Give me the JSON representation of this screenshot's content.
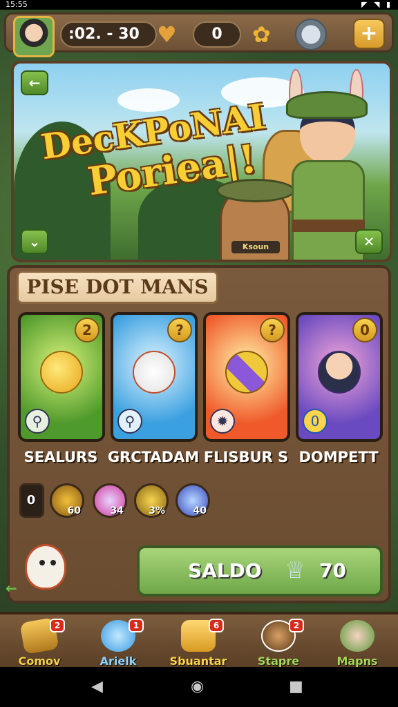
{
  "status": {
    "time": "15:55",
    "icons": [
      "image-icon",
      "mail-icon",
      "signal-icon",
      "wifi-icon",
      "battery-icon"
    ]
  },
  "topbar": {
    "timer": ":02. - 30",
    "coins": "0",
    "icons": {
      "avatar": "player-avatar",
      "heart": "heart-icon",
      "flower": "flower-icon",
      "pet": "pet-raccoon-icon",
      "plus": "plus-icon"
    }
  },
  "banner": {
    "title_line1": "DecKPoNAI",
    "title_line2": "Poriea|!",
    "ranger_tag": "Ksoun",
    "buttons": {
      "back": "←",
      "down": "⌄",
      "close": "✕"
    }
  },
  "panel": {
    "title": "PISE DOT MANS",
    "cards": [
      {
        "label": "SEALURS",
        "badge": "2",
        "color": "#4f9a2c"
      },
      {
        "label": "GRCTADAM",
        "badge": "?",
        "color": "#3aa0e0"
      },
      {
        "label": "FLISBUR S",
        "badge": "?",
        "color": "#f05a2a"
      },
      {
        "label": "DOMPETT",
        "badge": "0",
        "color": "#6a4ac0"
      }
    ],
    "resources": [
      {
        "value": "0",
        "sub": "0"
      },
      {
        "value": "60"
      },
      {
        "value": "34"
      },
      {
        "value": "3%"
      },
      {
        "value": "40"
      }
    ],
    "saldo": {
      "label": "SALDO",
      "amount": "70"
    }
  },
  "bottom_nav": [
    {
      "label": "Comov",
      "count": "2",
      "icon": "bundle-icon"
    },
    {
      "label": "Arielk",
      "count": "1",
      "icon": "cloud-icon"
    },
    {
      "label": "Sbuantar",
      "count": "6",
      "icon": "crate-icon"
    },
    {
      "label": "Stapre",
      "count": "2",
      "icon": "portrait-icon"
    },
    {
      "label": "Mapns",
      "count": "",
      "icon": "map-portrait-icon"
    }
  ],
  "android_nav": {
    "back": "◀",
    "home": "◉",
    "recents": "■"
  }
}
